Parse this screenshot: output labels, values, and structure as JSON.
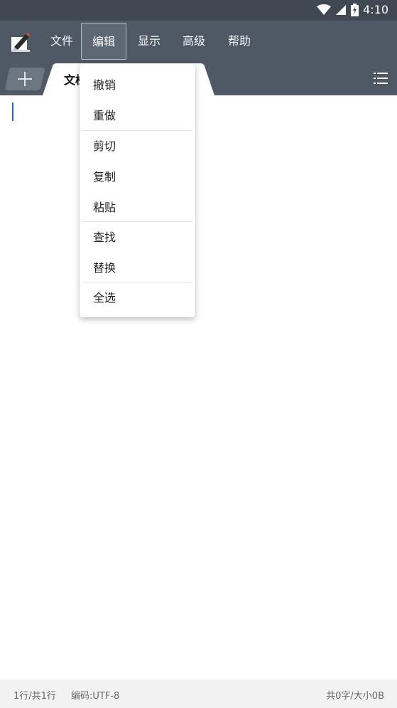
{
  "status_bar": {
    "time": "4:10",
    "icons": [
      "wifi-icon",
      "cell-signal-icon",
      "battery-charging-icon"
    ]
  },
  "menu_bar": {
    "logo_icon": "notepad-pen-icon",
    "items": [
      {
        "label": "文件"
      },
      {
        "label": "编辑"
      },
      {
        "label": "显示"
      },
      {
        "label": "高级"
      },
      {
        "label": "帮助"
      }
    ],
    "active_item": "编辑"
  },
  "tab_bar": {
    "add_icon": "plus-icon",
    "tab_title": "文档",
    "list_icon": "list-icon"
  },
  "edit_menu": {
    "items": [
      {
        "label": "撤销"
      },
      {
        "label": "重做"
      },
      {
        "label": "剪切"
      },
      {
        "label": "复制"
      },
      {
        "label": "粘贴"
      },
      {
        "label": "查找"
      },
      {
        "label": "替换"
      },
      {
        "label": "全选"
      }
    ]
  },
  "footer": {
    "line_info": "1行/共1行",
    "encoding": "编码:UTF-8",
    "size_info": "共0字/大小0B"
  },
  "colors": {
    "status_bar": "#3f4853",
    "toolbar": "#4f5965",
    "caret": "#1e66c9",
    "footer_bg": "#f2f2f2"
  }
}
